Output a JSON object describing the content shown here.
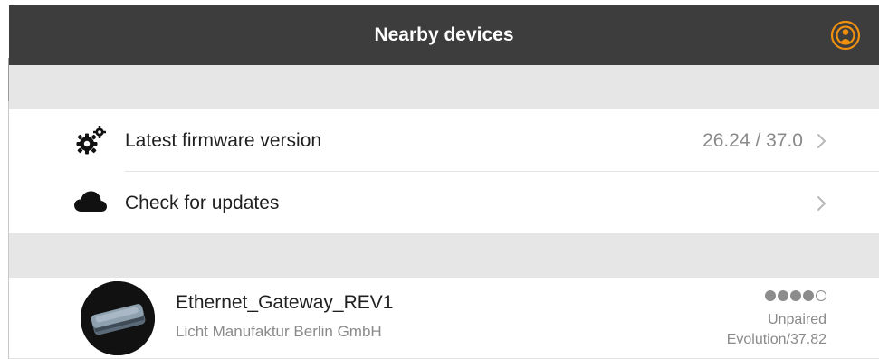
{
  "header": {
    "title": "Nearby devices",
    "broadcast_icon": "broadcast-icon",
    "accent_color": "#f0900f"
  },
  "settings": {
    "firmware": {
      "icon": "gears-icon",
      "label": "Latest firmware version",
      "value": "26.24 / 37.0"
    },
    "updates": {
      "icon": "cloud-icon",
      "label": "Check for updates"
    }
  },
  "devices": [
    {
      "name": "Ethernet_Gateway_REV1",
      "vendor": "Licht Manufaktur Berlin GmbH",
      "signal_strength": 4,
      "signal_max": 5,
      "status": "Unpaired",
      "version": "Evolution/37.82"
    }
  ],
  "colors": {
    "header_bg": "#3d3d3d",
    "section_band": "#e6e6e6",
    "secondary_text": "#8a8a8a"
  }
}
